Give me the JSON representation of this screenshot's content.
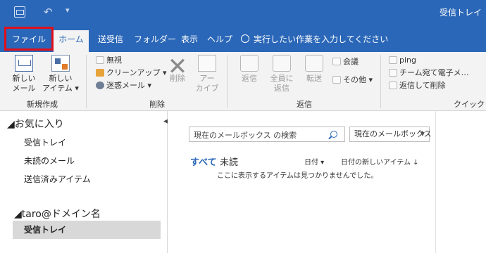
{
  "titlebar": {
    "window_title": "受信トレイ",
    "icons": [
      "app-icon",
      "undo-icon",
      "qat-customize-icon"
    ]
  },
  "tabs": {
    "file": "ファイル",
    "home": "ホーム",
    "send_receive": "送受信",
    "folder": "フォルダー",
    "view": "表示",
    "help": "ヘルプ",
    "tell_me": "実行したい作業を入力してください"
  },
  "ribbon": {
    "new_group": {
      "label": "新規作成",
      "new_mail": "新しい\nメール",
      "new_items": "新しい\nアイテム ▾"
    },
    "delete_group": {
      "label": "削除",
      "ignore": "無視",
      "cleanup": "クリーンアップ ▾",
      "junk": "迷惑メール ▾",
      "delete": "削除",
      "archive": "アー\nカイブ"
    },
    "respond_group": {
      "label": "返信",
      "reply": "返信",
      "reply_all": "全員に\n返信",
      "forward": "転送",
      "meeting": "会議",
      "more": "その他 ▾"
    },
    "quicksteps_group": {
      "label": "クイック",
      "ping": "ping",
      "team_mail": "チーム宛て電子メ…",
      "reply_delete": "返信して削除"
    }
  },
  "folderpane": {
    "favorites_header": "◢お気に入り",
    "favorites": [
      "受信トレイ",
      "未読のメール",
      "送信済みアイテム"
    ],
    "account_header": "◢taro@ドメイン名",
    "account_selected": "受信トレイ"
  },
  "messagelist": {
    "search_placeholder": "現在のメールボックス の検索",
    "scope": "現在のメールボックス",
    "filter_all": "すべて",
    "filter_unread": "未読",
    "sort_by": "日付 ▾",
    "sort_order": "日付の新しいアイテム ↓",
    "empty_text": "ここに表示するアイテムは見つかりませんでした。"
  }
}
